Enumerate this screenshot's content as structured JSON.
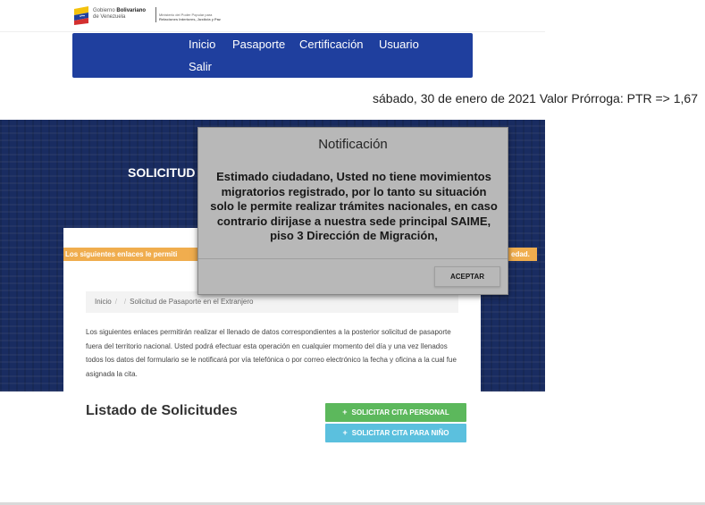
{
  "header": {
    "logo_line1": "Gobierno",
    "logo_line1_bold": "Bolivariano",
    "logo_line2": "de Venezuela",
    "ministry_line1": "Ministerio del Poder Popular para",
    "ministry_line2": "Relaciones Interiores, Justicia y Paz"
  },
  "nav": {
    "items": [
      {
        "label": "Inicio"
      },
      {
        "label": "Pasaporte"
      },
      {
        "label": "Certificación"
      },
      {
        "label": "Usuario"
      },
      {
        "label": "Salir"
      }
    ]
  },
  "dateline": "sábado, 30 de enero de 2021 Valor Prórroga: PTR => 1,67",
  "hero": {
    "title": "SOLICITUD"
  },
  "banner": {
    "left_text": "Los siguientes enlaces le permiti",
    "right_text": "edad."
  },
  "breadcrumb": {
    "home": "Inicio",
    "current": "Solicitud de Pasaporte en el Extranjero"
  },
  "intro_paragraph": "Los siguientes enlaces permitirán realizar el llenado de datos correspondientes a la posterior solicitud de pasaporte fuera del territorio nacional. Usted podrá efectuar esta operación en cualquier momento del día y una vez llenados todos los datos del formulario se le notificará por vía telefónica o por correo electrónico la fecha y oficina a la cual fue asignada la cita.",
  "list": {
    "title": "Listado de Solicitudes",
    "btn_personal": "SOLICITAR CITA PERSONAL",
    "btn_child": "SOLICITAR CITA PARA NIÑO",
    "plus_glyph": "+"
  },
  "dialog": {
    "title": "Notificación",
    "message": "Estimado ciudadano, Usted no tiene movimientos migratorios registrado, por lo tanto su situación solo le permite realizar trámites nacionales, en caso contrario dirijase a nuestra sede principal SAIME, piso 3 Dirección de Migración,",
    "accept": "ACEPTAR"
  },
  "colors": {
    "nav_bg": "#1f3f9e",
    "banner_orange": "#f0ad4e",
    "btn_green": "#5cb85c",
    "btn_blue": "#5bc0de"
  }
}
